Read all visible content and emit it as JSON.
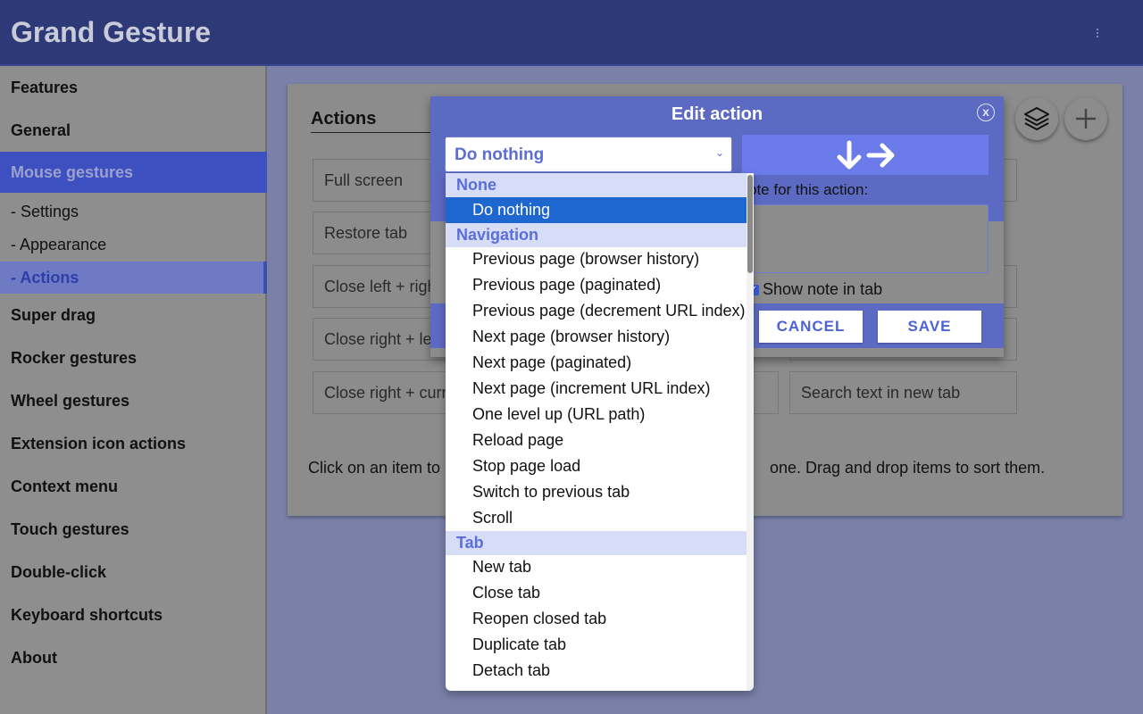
{
  "app": {
    "title": "Grand Gesture"
  },
  "sidebar": {
    "items": [
      {
        "label": "Features"
      },
      {
        "label": "General"
      },
      {
        "label": "Mouse gestures"
      },
      {
        "label": "- Settings"
      },
      {
        "label": "- Appearance"
      },
      {
        "label": "- Actions"
      },
      {
        "label": "Super drag"
      },
      {
        "label": "Rocker gestures"
      },
      {
        "label": "Wheel gestures"
      },
      {
        "label": "Extension icon actions"
      },
      {
        "label": "Context menu"
      },
      {
        "label": "Touch gestures"
      },
      {
        "label": "Double-click"
      },
      {
        "label": "Keyboard shortcuts"
      },
      {
        "label": "About"
      }
    ]
  },
  "main": {
    "title": "Actions",
    "actions": [
      {
        "label": "Full screen"
      },
      {
        "label": "Restore tab"
      },
      {
        "label": "Close left + right"
      },
      {
        "label": "Close right + left"
      },
      {
        "label": "Close right + current"
      },
      {
        "label": "Search text in new tab"
      }
    ],
    "hint_left": "Click on an item to",
    "hint_right": "one. Drag and drop items to sort them."
  },
  "dialog": {
    "title": "Edit action",
    "close_label": "x",
    "note_label": "ote for this action:",
    "show_note_label": "Show note in tab",
    "cancel_label": "CANCEL",
    "save_label": "SAVE",
    "gesture": "down-right"
  },
  "select": {
    "value": "Do nothing",
    "groups": [
      {
        "label": "None",
        "options": [
          "Do nothing"
        ]
      },
      {
        "label": "Navigation",
        "options": [
          "Previous page (browser history)",
          "Previous page (paginated)",
          "Previous page (decrement URL index)",
          "Next page (browser history)",
          "Next page (paginated)",
          "Next page (increment URL index)",
          "One level up (URL path)",
          "Reload page",
          "Stop page load",
          "Switch to previous tab",
          "Scroll"
        ]
      },
      {
        "label": "Tab",
        "options": [
          "New tab",
          "Close tab",
          "Reopen closed tab",
          "Duplicate tab",
          "Detach tab"
        ]
      }
    ]
  },
  "colors": {
    "header": "#2e3a78",
    "accent": "#5c6ac4",
    "selected_option": "#1e66d0"
  }
}
